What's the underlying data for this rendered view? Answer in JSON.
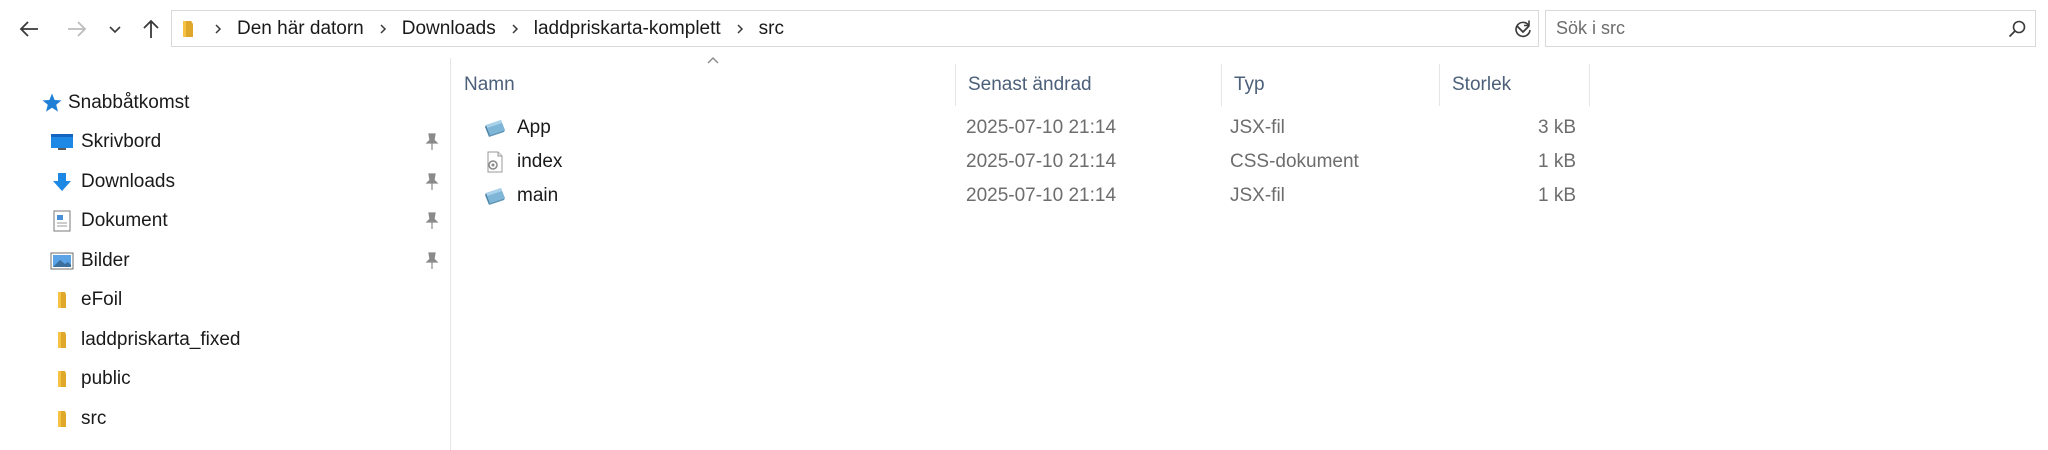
{
  "navigation": {
    "back_icon": "arrow-left-icon",
    "forward_icon": "arrow-right-icon",
    "recent_icon": "chevron-down-icon",
    "up_icon": "arrow-up-icon"
  },
  "address": {
    "breadcrumbs": [
      "Den här datorn",
      "Downloads",
      "laddpriskarta-komplett",
      "src"
    ]
  },
  "search": {
    "placeholder": "Sök i src"
  },
  "sidebar": {
    "quick_access": "Snabbåtkomst",
    "items": [
      {
        "label": "Skrivbord",
        "icon": "desktop-icon",
        "pinned": true
      },
      {
        "label": "Downloads",
        "icon": "download-arrow-icon",
        "pinned": true
      },
      {
        "label": "Dokument",
        "icon": "document-icon",
        "pinned": true
      },
      {
        "label": "Bilder",
        "icon": "pictures-icon",
        "pinned": true
      },
      {
        "label": "eFoil",
        "icon": "folder-icon",
        "pinned": false
      },
      {
        "label": "laddpriskarta_fixed",
        "icon": "folder-icon",
        "pinned": false
      },
      {
        "label": "public",
        "icon": "folder-icon",
        "pinned": false
      },
      {
        "label": "src",
        "icon": "folder-icon",
        "pinned": false
      }
    ]
  },
  "file_list": {
    "columns": {
      "name": "Namn",
      "modified": "Senast ändrad",
      "type": "Typ",
      "size": "Storlek"
    },
    "files": [
      {
        "name": "App",
        "modified": "2025-07-10 21:14",
        "type": "JSX-fil",
        "size": "3 kB",
        "icon": "jsx-file-icon"
      },
      {
        "name": "index",
        "modified": "2025-07-10 21:14",
        "type": "CSS-dokument",
        "size": "1 kB",
        "icon": "css-file-icon"
      },
      {
        "name": "main",
        "modified": "2025-07-10 21:14",
        "type": "JSX-fil",
        "size": "1 kB",
        "icon": "jsx-file-icon"
      }
    ]
  },
  "colors": {
    "accent": "#1e7fd6",
    "folder": "#f5c244",
    "header_text": "#4c607a",
    "muted_text": "#6d6d6d"
  }
}
